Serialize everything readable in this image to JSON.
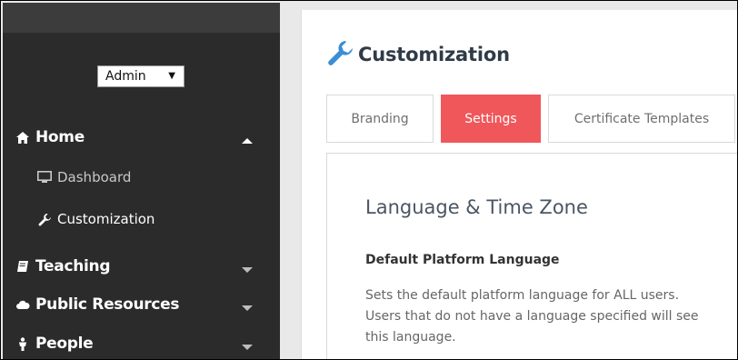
{
  "sidebar": {
    "role_select": {
      "value": "Admin"
    },
    "nav": {
      "home": {
        "label": "Home",
        "icon": "home-icon",
        "expanded": true
      },
      "dashboard": {
        "label": "Dashboard",
        "icon": "monitor-icon"
      },
      "customization": {
        "label": "Customization",
        "icon": "wrench-icon",
        "active": true
      },
      "teaching": {
        "label": "Teaching",
        "icon": "book-icon"
      },
      "public_resources": {
        "label": "Public Resources",
        "icon": "cloud-icon"
      },
      "people": {
        "label": "People",
        "icon": "person-icon"
      }
    }
  },
  "main": {
    "title": "Customization",
    "title_icon": "wrench-icon",
    "tabs": [
      {
        "label": "Branding",
        "active": false
      },
      {
        "label": "Settings",
        "active": true
      },
      {
        "label": "Certificate Templates",
        "active": false
      }
    ],
    "section": {
      "title": "Language & Time Zone",
      "field_label": "Default Platform Language",
      "description_lines": [
        "Sets the default platform language for ALL users.",
        "Users that do not have a language specified will see",
        "this language."
      ]
    }
  },
  "colors": {
    "sidebar_bg": "#2b2b2b",
    "accent_tab": "#f0575a",
    "title_icon": "#3a8fd6"
  }
}
